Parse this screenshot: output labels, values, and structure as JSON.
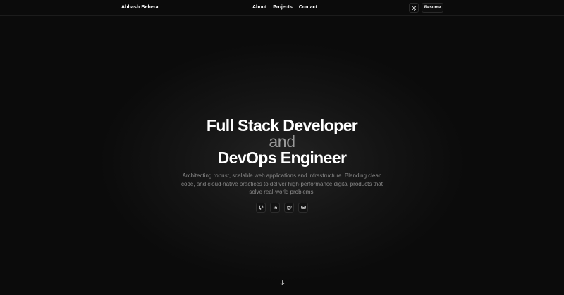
{
  "header": {
    "brand": "Abhash Behera",
    "nav": [
      {
        "label": "About"
      },
      {
        "label": "Projects"
      },
      {
        "label": "Contact"
      }
    ],
    "resume_label": "Resume",
    "theme_icon": "sun-icon"
  },
  "hero": {
    "line1": "Full Stack Developer",
    "connector": "and",
    "line2": "DevOps Engineer",
    "description": "Architecting robust, scalable web applications and infrastructure. Blending clean code, and cloud-native practices to deliver high-performance digital products that solve real-world problems.",
    "socials": [
      {
        "icon": "github-icon"
      },
      {
        "icon": "linkedin-icon"
      },
      {
        "icon": "twitter-icon"
      },
      {
        "icon": "mail-icon"
      }
    ]
  },
  "scroll_icon": "chevron-down-icon",
  "colors": {
    "background": "#0b0b0b",
    "text": "#ffffff",
    "muted": "#8a8a8a",
    "connector": "#9a9a9a"
  }
}
